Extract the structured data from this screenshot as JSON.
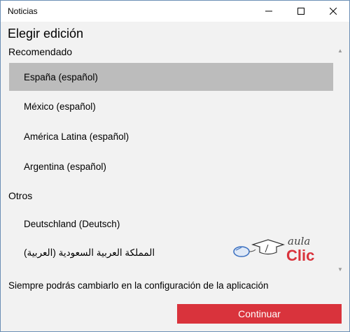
{
  "window": {
    "title": "Noticias",
    "minimize_icon": "minimize-icon",
    "maximize_icon": "maximize-icon",
    "close_icon": "close-icon"
  },
  "heading": "Elegir edición",
  "sections": {
    "recommended": {
      "label": "Recomendado",
      "items": [
        "España (español)",
        "México (español)",
        "América Latina (español)",
        "Argentina (español)"
      ]
    },
    "others": {
      "label": "Otros",
      "items": [
        "Deutschland (Deutsch)",
        "المملكة العربية السعودية (العربية)"
      ]
    }
  },
  "selected_item": "España (español)",
  "scrollbar": {
    "up_icon": "scroll-up-arrow-icon",
    "down_icon": "scroll-down-arrow-icon"
  },
  "logo": {
    "word_top": "aula",
    "word_bottom": "Clic",
    "icon": "mouse-graduation-cap-icon"
  },
  "footer": {
    "note": "Siempre podrás cambiarlo en la configuración de la aplicación",
    "continue_label": "Continuar"
  },
  "colors": {
    "accent": "#d9333c",
    "selected_bg": "#bcbcbc",
    "window_bg": "#f2f2f2"
  }
}
